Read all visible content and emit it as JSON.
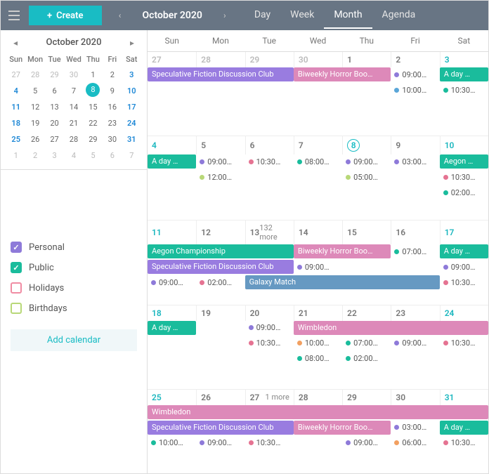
{
  "header": {
    "create": "Create",
    "month_label": "October 2020",
    "views": [
      "Day",
      "Week",
      "Month",
      "Agenda"
    ],
    "active_view": "Month"
  },
  "sidebar": {
    "mini": {
      "title": "October 2020",
      "dow": [
        "Sun",
        "Mon",
        "Tue",
        "Wed",
        "Thu",
        "Fri",
        "Sat"
      ],
      "weeks": [
        [
          {
            "n": 27,
            "cls": "other"
          },
          {
            "n": 28,
            "cls": "other"
          },
          {
            "n": 29,
            "cls": "other"
          },
          {
            "n": 30,
            "cls": "other"
          },
          {
            "n": 1
          },
          {
            "n": 2
          },
          {
            "n": 3,
            "cls": "sat"
          }
        ],
        [
          {
            "n": 4,
            "cls": "sat"
          },
          {
            "n": 5
          },
          {
            "n": 6
          },
          {
            "n": 7
          },
          {
            "n": 8,
            "cls": "today"
          },
          {
            "n": 9
          },
          {
            "n": 10,
            "cls": "sat"
          }
        ],
        [
          {
            "n": 11,
            "cls": "sat"
          },
          {
            "n": 12
          },
          {
            "n": 13
          },
          {
            "n": 14
          },
          {
            "n": 15
          },
          {
            "n": 16
          },
          {
            "n": 17,
            "cls": "sat"
          }
        ],
        [
          {
            "n": 18,
            "cls": "sat"
          },
          {
            "n": 19
          },
          {
            "n": 20
          },
          {
            "n": 21
          },
          {
            "n": 22
          },
          {
            "n": 23
          },
          {
            "n": 24,
            "cls": "sat"
          }
        ],
        [
          {
            "n": 25,
            "cls": "sat"
          },
          {
            "n": 26
          },
          {
            "n": 27
          },
          {
            "n": 28
          },
          {
            "n": 29
          },
          {
            "n": 30
          },
          {
            "n": 31,
            "cls": "sat"
          }
        ],
        [
          {
            "n": 1,
            "cls": "other"
          },
          {
            "n": 2,
            "cls": "other"
          },
          {
            "n": 3,
            "cls": "other"
          },
          {
            "n": 4,
            "cls": "other"
          },
          {
            "n": 5,
            "cls": "other"
          },
          {
            "n": 6,
            "cls": "other"
          },
          {
            "n": 7,
            "cls": "other"
          }
        ]
      ]
    },
    "calendars": [
      {
        "label": "Personal",
        "color": "#8e7ad9",
        "checked": true
      },
      {
        "label": "Public",
        "color": "#1abc9c",
        "checked": true
      },
      {
        "label": "Holidays",
        "color": "#f08ca3",
        "checked": false
      },
      {
        "label": "Birthdays",
        "color": "#b8d878",
        "checked": false
      }
    ],
    "add_calendar": "Add calendar"
  },
  "dow": [
    "Sun",
    "Mon",
    "Tue",
    "Wed",
    "Thu",
    "Fri",
    "Sat"
  ],
  "colors": {
    "purple": "#997CE0",
    "teal": "#1abc9c",
    "pink": "#DD89B9",
    "blue": "#6699C2",
    "dot_purple": "#8e7ad9",
    "dot_teal": "#1abc9c",
    "dot_pink": "#e57392",
    "dot_blue": "#5aa6d8",
    "dot_green": "#b8d878",
    "dot_orange": "#f2a061"
  },
  "events": {
    "spec_fiction": "Speculative Fiction Discussion Club",
    "biweekly": "Biweekly Horror Boo…",
    "aday": "A day …",
    "aegon": "Aegon …",
    "aegon_full": "Aegon Championship",
    "galaxy": "Galaxy Match",
    "wimbledon": "Wimbledon",
    "t0900": "09:00…",
    "t1000": "10:00…",
    "t1030": "10:30…",
    "t1200": "12:00…",
    "t0800": "08:00…",
    "t0500": "05:00…",
    "t0300": "03:00…",
    "t0200": "02:00…",
    "t0700": "07:00…",
    "t0600": "06:00…",
    "more132": "132 more",
    "more1": "1 more"
  },
  "weeks": [
    {
      "dates": [
        {
          "n": 27,
          "cls": "other"
        },
        {
          "n": 28,
          "cls": "other"
        },
        {
          "n": 29,
          "cls": "other"
        },
        {
          "n": 30,
          "cls": "other"
        },
        {
          "n": 1
        },
        {
          "n": 2
        },
        {
          "n": 3,
          "cls": "sat"
        }
      ]
    },
    {
      "dates": [
        {
          "n": 4,
          "cls": "sat"
        },
        {
          "n": 5
        },
        {
          "n": 6
        },
        {
          "n": 7
        },
        {
          "n": 8,
          "cls": "today"
        },
        {
          "n": 9
        },
        {
          "n": 10,
          "cls": "sat"
        }
      ]
    },
    {
      "dates": [
        {
          "n": 11,
          "cls": "sat"
        },
        {
          "n": 12
        },
        {
          "n": 13,
          "more": "more132"
        },
        {
          "n": 14
        },
        {
          "n": 15
        },
        {
          "n": 16
        },
        {
          "n": 17,
          "cls": "sat"
        }
      ]
    },
    {
      "dates": [
        {
          "n": 18,
          "cls": "sat"
        },
        {
          "n": 19
        },
        {
          "n": 20
        },
        {
          "n": 21
        },
        {
          "n": 22
        },
        {
          "n": 23
        },
        {
          "n": 24,
          "cls": "sat"
        }
      ]
    },
    {
      "dates": [
        {
          "n": 25,
          "cls": "sat"
        },
        {
          "n": 26
        },
        {
          "n": 27,
          "more": "more1"
        },
        {
          "n": 28
        },
        {
          "n": 29
        },
        {
          "n": 30
        },
        {
          "n": 31,
          "cls": "sat"
        }
      ]
    }
  ]
}
